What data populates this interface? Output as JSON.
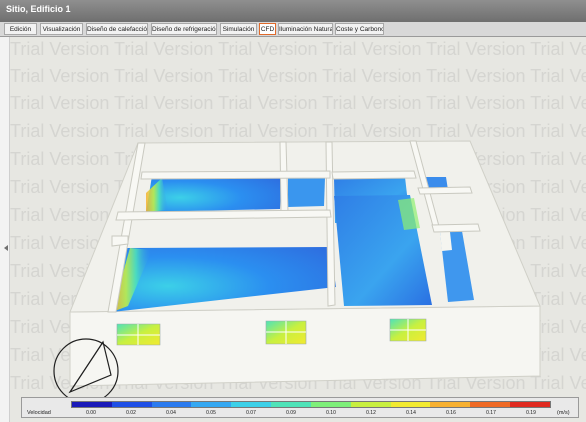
{
  "window": {
    "title": "Sitio, Edificio 1"
  },
  "tabs": [
    {
      "label": "Edición",
      "active": false
    },
    {
      "label": "Visualización",
      "active": false
    },
    {
      "label": "Diseño de calefacción",
      "active": false
    },
    {
      "label": "Diseño de refrigeración",
      "active": false
    },
    {
      "label": "Simulación",
      "active": false
    },
    {
      "label": "CFD",
      "active": true
    },
    {
      "label": "Iluminación Natural",
      "active": false
    },
    {
      "label": "Coste y Carbono",
      "active": false
    }
  ],
  "watermark": "Trial Version Trial Version Trial Version Trial Version Trial Version Trial Version Trial Version Trial Version Trial Version",
  "legend": {
    "label": "Velocidad",
    "unit": "(m/s)",
    "ticks": [
      "0.00",
      "0.02",
      "0.04",
      "0.05",
      "0.07",
      "0.09",
      "0.10",
      "0.12",
      "0.14",
      "0.16",
      "0.17",
      "0.19"
    ],
    "colors": [
      "#1a1ab8",
      "#1f4fe6",
      "#2b7bf0",
      "#35a8f2",
      "#3cd0e8",
      "#4fe3b8",
      "#7ff07a",
      "#c8f040",
      "#f2ea30",
      "#f7b030",
      "#f06a25",
      "#e02a20"
    ]
  },
  "compass": {
    "icon": "compass-icon"
  }
}
